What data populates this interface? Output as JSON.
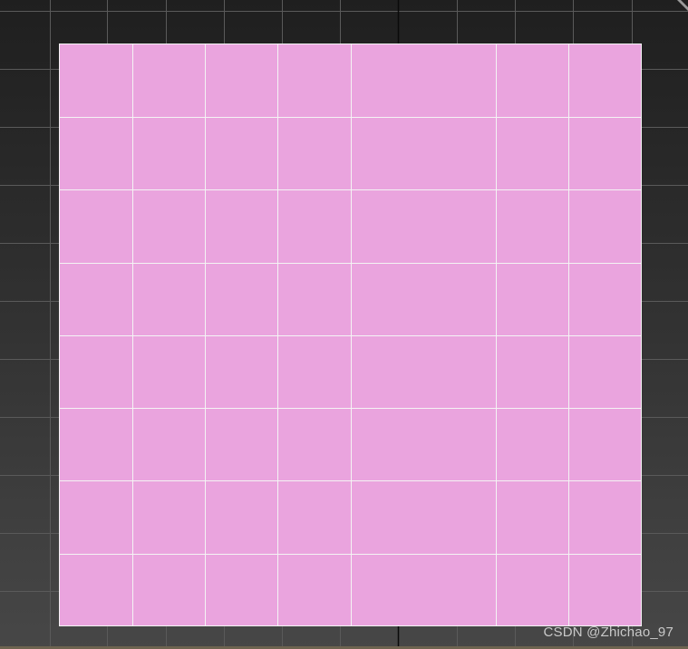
{
  "viewport": {
    "background_top": "#1f1f1f",
    "background_bottom": "#474747",
    "home_grid_color": "#5a5a5a",
    "home_grid_axis_color": "#0a0a0a"
  },
  "plane": {
    "color": "#eaa4de",
    "wire_color": "#f4f4f4",
    "visible_columns": 7,
    "visible_rows": 8
  },
  "watermark": {
    "text": "CSDN @Zhichao_97"
  }
}
